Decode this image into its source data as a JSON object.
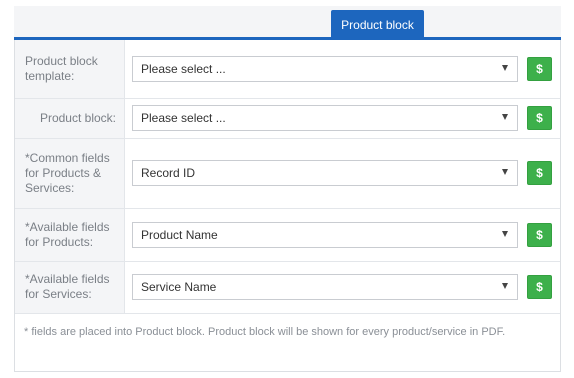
{
  "tabs": [
    {
      "label": "Product block",
      "active": true
    }
  ],
  "accent_color": "#1d66be",
  "button_color": "#3db04b",
  "form": {
    "rows": [
      {
        "label": "Product block template:",
        "value": "Please select ...",
        "button": "$"
      },
      {
        "label": "Product block:",
        "value": "Please select ...",
        "button": "$"
      },
      {
        "label": "*Common fields for Products & Services:",
        "value": "Record ID",
        "button": "$"
      },
      {
        "label": "*Available fields for Products:",
        "value": "Product Name",
        "button": "$"
      },
      {
        "label": "*Available fields for Services:",
        "value": "Service Name",
        "button": "$"
      }
    ]
  },
  "note": "* fields are placed into Product block. Product block will be shown for every product/service in PDF."
}
